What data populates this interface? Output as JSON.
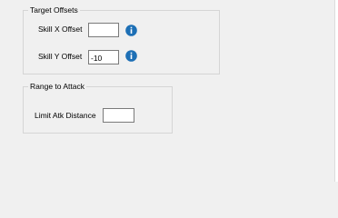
{
  "target_offsets": {
    "title": "Target Offsets",
    "skill_x": {
      "label": "Skill X Offset",
      "value": ""
    },
    "skill_y": {
      "label": "Skill Y Offset",
      "value": "-10"
    }
  },
  "range_to_attack": {
    "title": "Range to Attack",
    "limit": {
      "label": "Limit Atk Distance",
      "value": ""
    }
  },
  "icons": {
    "info": "info-icon",
    "accent": "#1d6fb5"
  }
}
